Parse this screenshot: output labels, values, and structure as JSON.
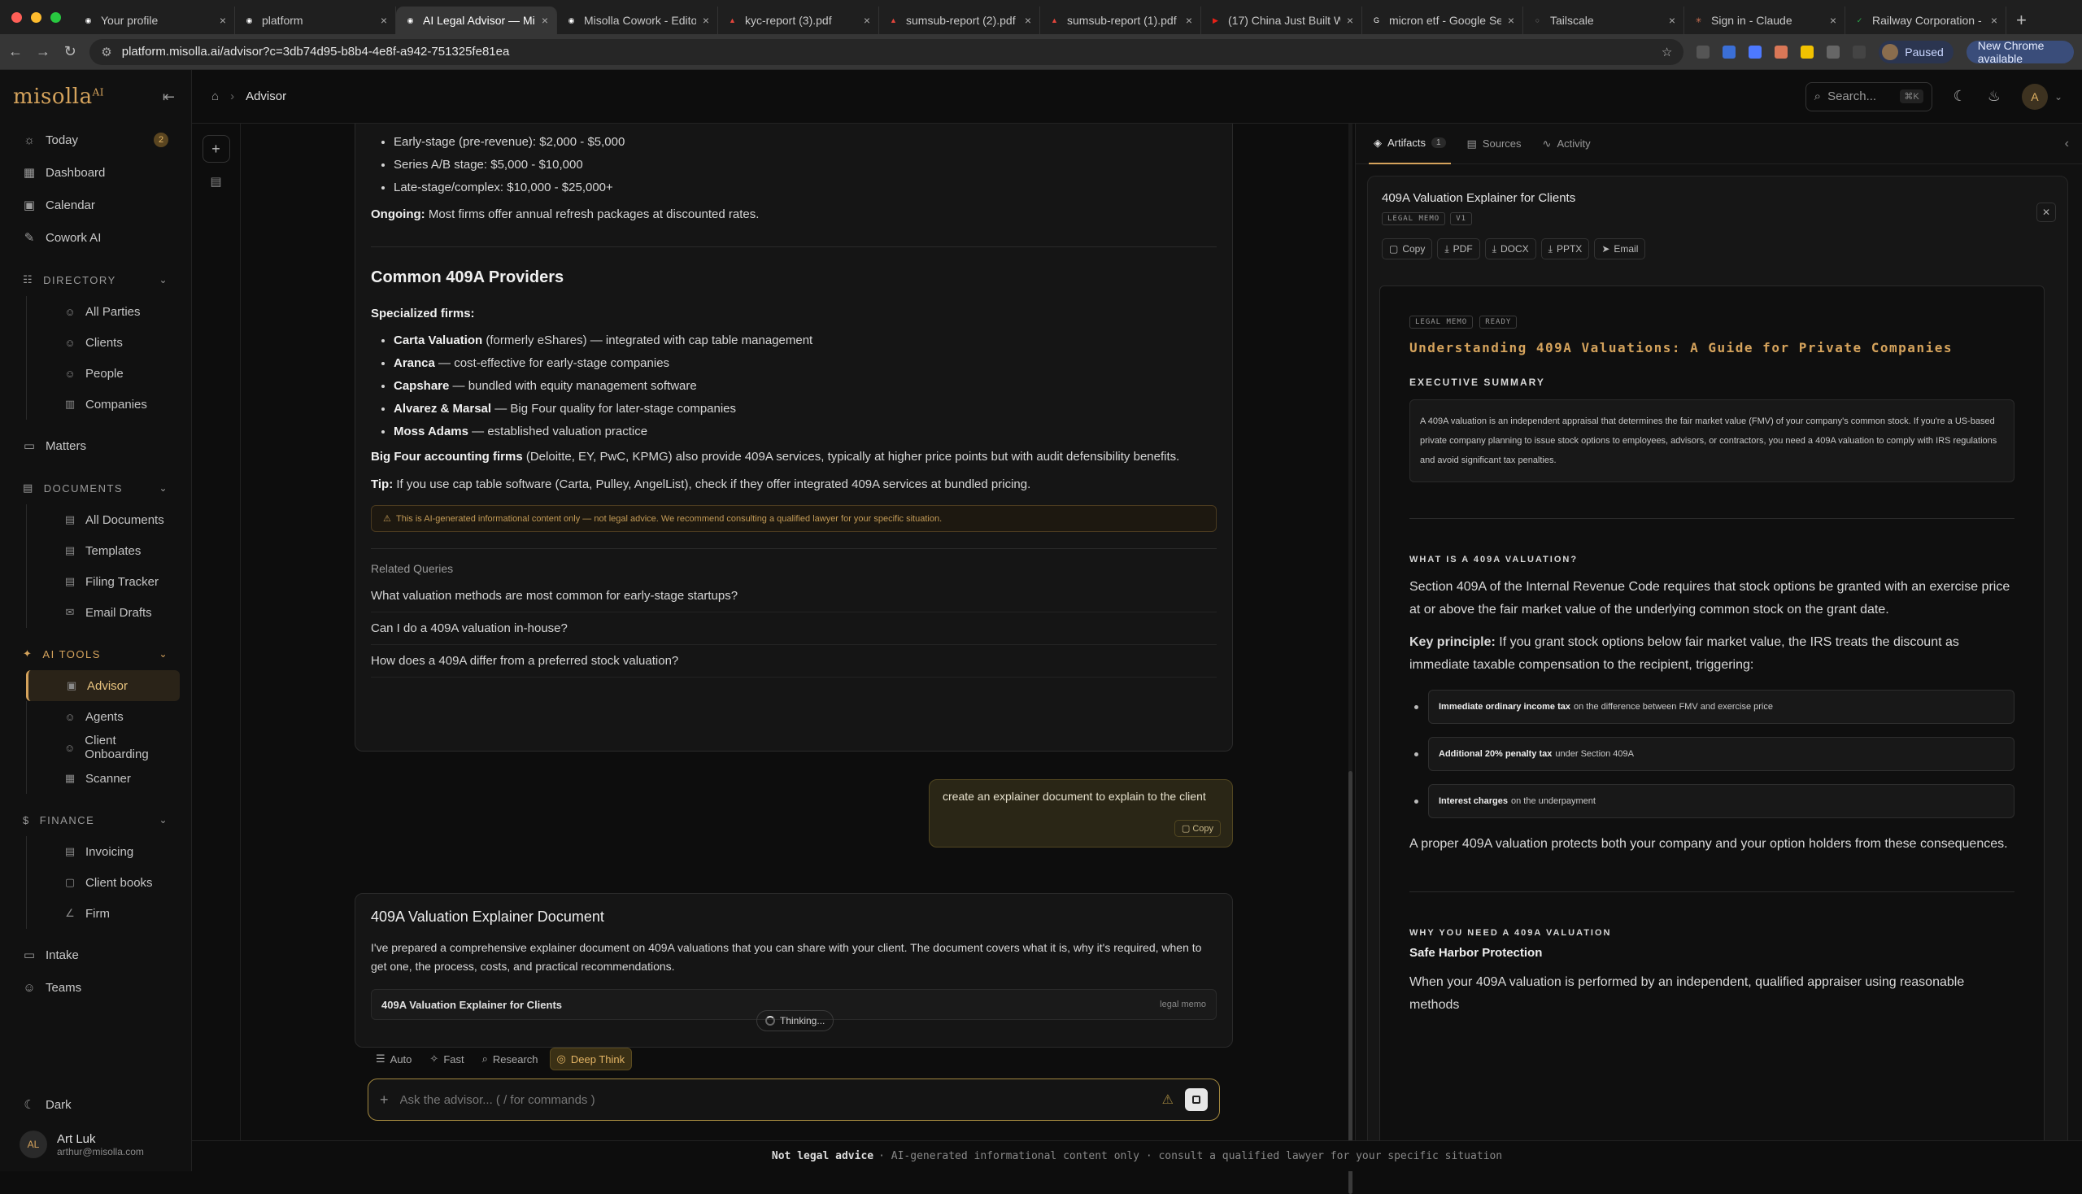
{
  "browser": {
    "tabs": [
      {
        "title": "Your profile",
        "color": "#ffffff",
        "glyph": "◉"
      },
      {
        "title": "platform",
        "color": "#ffffff",
        "glyph": "◉"
      },
      {
        "title": "AI Legal Advisor — Mis",
        "color": "#ffffff",
        "glyph": "◉",
        "active": true
      },
      {
        "title": "Misolla Cowork - Edito",
        "color": "#ffffff",
        "glyph": "◉"
      },
      {
        "title": "kyc-report (3).pdf",
        "color": "#e2453c",
        "glyph": "▲"
      },
      {
        "title": "sumsub-report (2).pdf",
        "color": "#e2453c",
        "glyph": "▲"
      },
      {
        "title": "sumsub-report (1).pdf",
        "color": "#e2453c",
        "glyph": "▲"
      },
      {
        "title": "(17) China Just Built W",
        "color": "#e62117",
        "glyph": "▶"
      },
      {
        "title": "micron etf - Google Se",
        "color": "#ffffff",
        "glyph": "G"
      },
      {
        "title": "Tailscale",
        "color": "#777777",
        "glyph": "○"
      },
      {
        "title": "Sign in - Claude",
        "color": "#d97757",
        "glyph": "✳"
      },
      {
        "title": "Railway Corporation -",
        "color": "#2bb24c",
        "glyph": "✓"
      }
    ],
    "url": "platform.misolla.ai/advisor?c=3db74d95-b8b4-4e8f-a942-751325fe81ea",
    "paused_label": "Paused",
    "chrome_update": "New Chrome available"
  },
  "sidebar": {
    "logo": "misolla",
    "logo_sup": "AI",
    "top": [
      {
        "icon": "☼",
        "label": "Today",
        "badge": "2"
      },
      {
        "icon": "▦",
        "label": "Dashboard"
      },
      {
        "icon": "▣",
        "label": "Calendar"
      },
      {
        "icon": "✎",
        "label": "Cowork AI"
      }
    ],
    "directory": {
      "title": "DIRECTORY",
      "items": [
        "All Parties",
        "Clients",
        "People",
        "Companies"
      ]
    },
    "matters": "Matters",
    "documents": {
      "title": "DOCUMENTS",
      "items": [
        "All Documents",
        "Templates",
        "Filing Tracker",
        "Email Drafts"
      ]
    },
    "ai_tools": {
      "title": "AI TOOLS",
      "items": [
        "Advisor",
        "Agents",
        "Client Onboarding",
        "Scanner"
      ]
    },
    "finance": {
      "title": "FINANCE",
      "items": [
        "Invoicing",
        "Client books",
        "Firm"
      ]
    },
    "bottom": [
      "Intake",
      "Teams"
    ],
    "theme": "Dark",
    "user": {
      "initials": "AL",
      "name": "Art Luk",
      "email": "arthur@misolla.com"
    }
  },
  "topbar": {
    "breadcrumb": "Advisor",
    "search_placeholder": "Search...",
    "search_kbd": "⌘K",
    "avatar": "A"
  },
  "chat": {
    "costs": [
      "Early-stage (pre-revenue): $2,000 - $5,000",
      "Series A/B stage: $5,000 - $10,000",
      "Late-stage/complex: $10,000 - $25,000+"
    ],
    "ongoing_label": "Ongoing:",
    "ongoing_text": " Most firms offer annual refresh packages at discounted rates.",
    "providers_heading": "Common 409A Providers",
    "specialized_label": "Specialized firms:",
    "providers": [
      {
        "name": "Carta Valuation",
        "desc": " (formerly eShares) — integrated with cap table management"
      },
      {
        "name": "Aranca",
        "desc": " — cost-effective for early-stage companies"
      },
      {
        "name": "Capshare",
        "desc": " — bundled with equity management software"
      },
      {
        "name": "Alvarez & Marsal",
        "desc": " — Big Four quality for later-stage companies"
      },
      {
        "name": "Moss Adams",
        "desc": " — established valuation practice"
      }
    ],
    "bigfour_label": "Big Four accounting firms",
    "bigfour_text": " (Deloitte, EY, PwC, KPMG) also provide 409A services, typically at higher price points but with audit defensibility benefits.",
    "tip_label": "Tip:",
    "tip_text": " If you use cap table software (Carta, Pulley, AngelList), check if they offer integrated 409A services at bundled pricing.",
    "disclaimer": "This is AI-generated informational content only — not legal advice. We recommend consulting a qualified lawyer for your specific situation.",
    "related_title": "Related Queries",
    "related": [
      "What valuation methods are most common for early-stage startups?",
      "Can I do a 409A valuation in-house?",
      "How does a 409A differ from a preferred stock valuation?"
    ],
    "user_message": "create an explainer document to explain to the client",
    "copy_label": "Copy",
    "response_title": "409A Valuation Explainer Document",
    "response_text": "I've prepared a comprehensive explainer document on 409A valuations that you can share with your client. The document covers what it is, why it's required, when to get one, the process, costs, and practical recommendations.",
    "doc_name": "409A Valuation Explainer for Clients",
    "doc_tag": "legal memo",
    "thinking": "Thinking...",
    "modes": [
      "Auto",
      "Fast",
      "Research",
      "Deep Think"
    ],
    "composer_placeholder": "Ask the advisor... ( / for commands )"
  },
  "panel": {
    "tabs": [
      {
        "label": "Artifacts",
        "count": "1"
      },
      {
        "label": "Sources"
      },
      {
        "label": "Activity"
      }
    ],
    "artifact_title": "409A Valuation Explainer for Clients",
    "tags": [
      "LEGAL MEMO",
      "V1"
    ],
    "actions": [
      "Copy",
      "PDF",
      "DOCX",
      "PPTX",
      "Email"
    ],
    "doc": {
      "tags": [
        "LEGAL MEMO",
        "READY"
      ],
      "title": "Understanding 409A Valuations: A Guide for Private Companies",
      "exec_heading": "EXECUTIVE SUMMARY",
      "exec_text": "A 409A valuation is an independent appraisal that determines the fair market value (FMV) of your company's common stock. If you're a US-based private company planning to issue stock options to employees, advisors, or contractors, you need a 409A valuation to comply with IRS regulations and avoid significant tax penalties.",
      "what_heading": "WHAT IS A 409A VALUATION?",
      "what_text": "Section 409A of the Internal Revenue Code requires that stock options be granted with an exercise price at or above the fair market value of the underlying common stock on the grant date.",
      "key_label": "Key principle:",
      "key_text": " If you grant stock options below fair market value, the IRS treats the discount as immediate taxable compensation to the recipient, triggering:",
      "bullets": [
        {
          "b": "Immediate ordinary income tax",
          "t": "on the difference between FMV and exercise price"
        },
        {
          "b": "Additional 20% penalty tax",
          "t": "under Section 409A"
        },
        {
          "b": "Interest charges",
          "t": "on the underpayment"
        }
      ],
      "protect_text": "A proper 409A valuation protects both your company and your option holders from these consequences.",
      "why_heading": "WHY YOU NEED A 409A VALUATION",
      "safe_harbor": "Safe Harbor Protection",
      "safe_text": "When your 409A valuation is performed by an independent, qualified appraiser using reasonable methods"
    }
  },
  "footer": {
    "bold": "Not legal advice",
    "text": "· AI-generated informational content only · consult a qualified lawyer for your specific situation"
  }
}
